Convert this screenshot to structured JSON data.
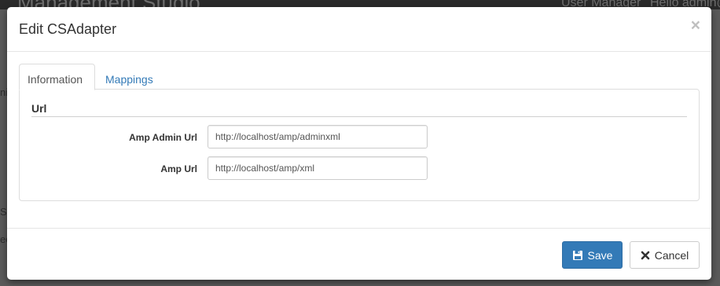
{
  "background": {
    "app_title": "Management Studio",
    "nav_user_manager": "User Manager",
    "nav_hello": "Hello admin@",
    "fragments": [
      "ni",
      "Sea",
      "ee"
    ]
  },
  "modal": {
    "title": "Edit CSAdapter",
    "close_glyph": "×",
    "tabs": [
      {
        "label": "Information",
        "active": true
      },
      {
        "label": "Mappings",
        "active": false
      }
    ],
    "section_title": "Url",
    "fields": [
      {
        "label": "Amp Admin Url",
        "value": "http://localhost/amp/adminxml"
      },
      {
        "label": "Amp Url",
        "value": "http://localhost/amp/xml"
      }
    ],
    "footer": {
      "save_label": "Save",
      "save_icon": "save-icon",
      "cancel_label": "Cancel",
      "cancel_icon": "close-icon"
    }
  },
  "colors": {
    "primary": "#337ab7",
    "link": "#337ab7",
    "overlay": "#5f5f5f"
  }
}
